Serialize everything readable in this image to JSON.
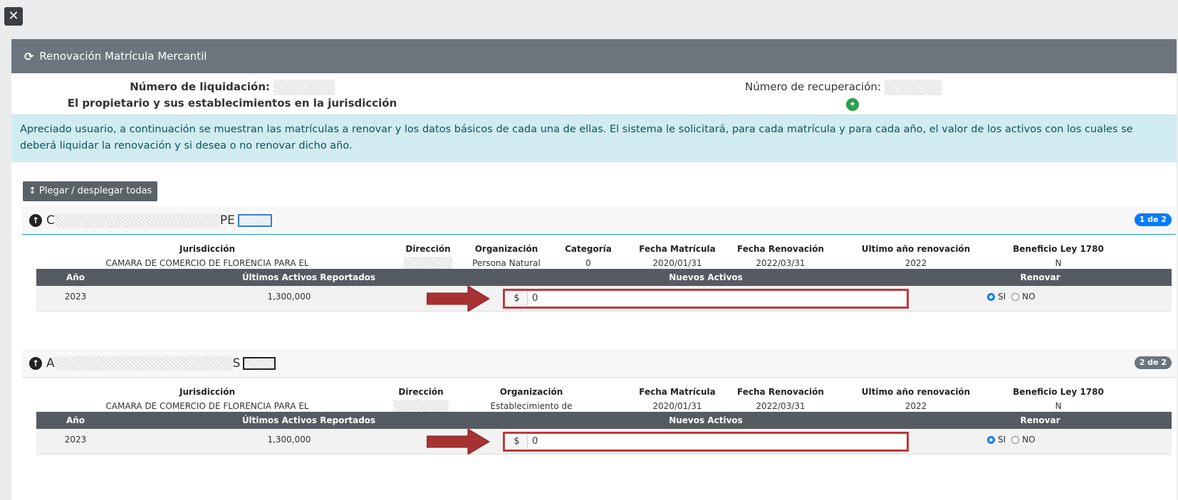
{
  "close_label": "✕",
  "modal_title": "Renovación Matrícula Mercantil",
  "liquidation_label": "Número de liquidación:",
  "owner_text": "El propietario y sus establecimientos en la jurisdicción",
  "recovery_label": "Número de recuperación:",
  "alert_text": "Apreciado usuario, a continuación se muestran las matrículas a renovar y los datos básicos de cada una de ellas. El sistema le solicitará, para cada matrícula y para cada año, el valor de los activos con los cuales se deberá liquidar la renovación y si desea o no renovar dicho año.",
  "toggle_all_label": "↕ Plegar / desplegar todas",
  "columns": {
    "jurisdiccion": "Jurisdicción",
    "direccion": "Dirección",
    "organizacion": "Organización",
    "categoria": "Categoría",
    "fecha_matricula": "Fecha Matrícula",
    "fecha_renovacion": "Fecha Renovación",
    "ultimo_anio": "Ultimo año renovación",
    "beneficio": "Beneficio Ley 1780"
  },
  "table_headers": {
    "anio": "Año",
    "ultimos_activos": "Últimos Activos Reportados",
    "nuevos_activos": "Nuevos Activos",
    "renovar": "Renovar"
  },
  "sections": [
    {
      "name_start": "C",
      "name_end": "PE",
      "badge": "1 de 2",
      "jurisdiccion": "CAMARA DE COMERCIO DE FLORENCIA PARA EL CAQUETA",
      "organizacion": "Persona Natural",
      "categoria": "0",
      "fecha_matricula": "2020/01/31",
      "fecha_renovacion": "2022/03/31",
      "ultimo_anio": "2022",
      "beneficio": "N",
      "row": {
        "anio": "2023",
        "ultimos_activos": "1,300,000",
        "currency": "$",
        "nuevos_activos": "0",
        "si": "SI",
        "no": "NO"
      }
    },
    {
      "name_start": "A",
      "name_end": "S",
      "badge": "2 de 2",
      "jurisdiccion": "CAMARA DE COMERCIO DE FLORENCIA PARA EL CAQUETA",
      "organizacion": "Establecimiento de Comercio",
      "fecha_matricula": "2020/01/31",
      "fecha_renovacion": "2022/03/31",
      "ultimo_anio": "2022",
      "beneficio": "N",
      "row": {
        "anio": "2023",
        "ultimos_activos": "1,300,000",
        "currency": "$",
        "nuevos_activos": "0",
        "si": "SI",
        "no": "NO"
      }
    }
  ],
  "colors": {
    "header_bg": "#6c757d",
    "alert_bg": "#d1ecf1",
    "highlight": "#c0393b",
    "badge_blue": "#007bff"
  }
}
